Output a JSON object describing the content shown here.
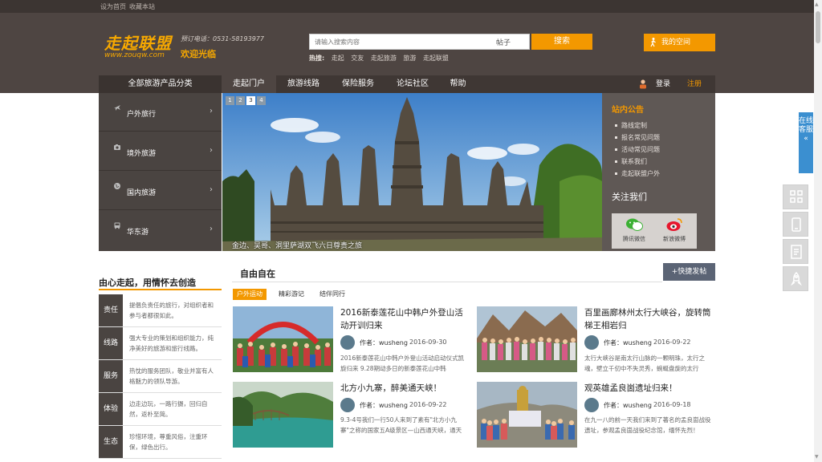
{
  "topbar": {
    "set_home": "设为首页",
    "bookmark": "收藏本站"
  },
  "header": {
    "logo": "走起联盟",
    "logo_url": "www.zouqw.com",
    "hotline": "预订电话：0531-58193977",
    "welcome": "欢迎光临",
    "search_placeholder": "请输入搜索内容",
    "search_type": "帖子",
    "search_button": "搜索",
    "hot_label": "热搜:",
    "hot_terms": [
      "走起",
      "交友",
      "走起旅游",
      "旅游",
      "走起联盟"
    ],
    "myspace": "我的空间"
  },
  "nav": {
    "category": "全部旅游产品分类",
    "items": [
      "走起门户",
      "旅游线路",
      "保险服务",
      "论坛社区",
      "帮助"
    ],
    "login": "登录",
    "register": "注册"
  },
  "categories": [
    "户外旅行",
    "境外旅游",
    "国内旅游",
    "华东游"
  ],
  "banner": {
    "pages": [
      "1",
      "2",
      "3",
      "4"
    ],
    "active_page": "3",
    "caption": "金边、吴哥、洞里萨湖双飞六日尊贵之旅"
  },
  "notice": {
    "title": "站内公告",
    "items": [
      "路线定制",
      "报名常见问题",
      "活动常见问题",
      "联系我们",
      "走起联盟户外"
    ],
    "follow": "关注我们",
    "wechat": "腾讯微信",
    "weibo": "新浪微博"
  },
  "motto": "由心走起，用情怀去创造",
  "features": [
    {
      "k": "责任",
      "v": "提倡负责任的旅行，对组织者和参与者都很如此。"
    },
    {
      "k": "线路",
      "v": "强大专业的策划和组织能力，纯净美好的旅游和旅行线路。"
    },
    {
      "k": "服务",
      "v": "热忱的服务团队，敬业并富有人格魅力的领队导游。"
    },
    {
      "k": "体验",
      "v": "边走边玩，一路行摄，回归自然，返朴至简。"
    },
    {
      "k": "生态",
      "v": "珍惜环境，尊重风俗，注重环保，绿色出行。"
    }
  ],
  "section": {
    "title": "自由自在",
    "post_button": "+快捷发帖",
    "tabs": [
      "户外运动",
      "精彩游记",
      "结伴同行"
    ]
  },
  "posts": [
    {
      "title": "2016新泰莲花山中韩户外登山活动开训归来",
      "author": "作者：wusheng",
      "date": "2016-09-30",
      "desc": "2016新泰莲花山中韩户外登山活动启动仪式凯旋归来 9.28期动多日的新泰莲花山中韩"
    },
    {
      "title": "百里画廊林州太行大峡谷，旋转筒梯王相岩归",
      "author": "作者：wusheng",
      "date": "2016-09-22",
      "desc": "太行大峡谷是南太行山脉的一颗明珠，太行之魂，壁立千仞中不失灵秀，蜿蜒盘旋的太行"
    },
    {
      "title": "北方小九寨，醉美通天峡！",
      "author": "作者：wusheng",
      "date": "2016-09-22",
      "desc": "9.3-4号我们一行50人来到了素有\"北方小九寨\"之称的国家五A级景区—山西通天峡，通天"
    },
    {
      "title": "观英雄孟良崮遗址归来！",
      "author": "作者：wusheng",
      "date": "2016-09-18",
      "desc": "在九一八的前一天我们来到了著名的孟良崮战役遗址，参观孟良崮战役纪念馆，缅怀先烈！"
    }
  ],
  "float": {
    "kefu": "在线客服"
  },
  "colors": {
    "accent": "#f39800",
    "header_bg": "#4e4542",
    "nav_bg": "#3f3734",
    "kefu": "#3b8fd0"
  }
}
